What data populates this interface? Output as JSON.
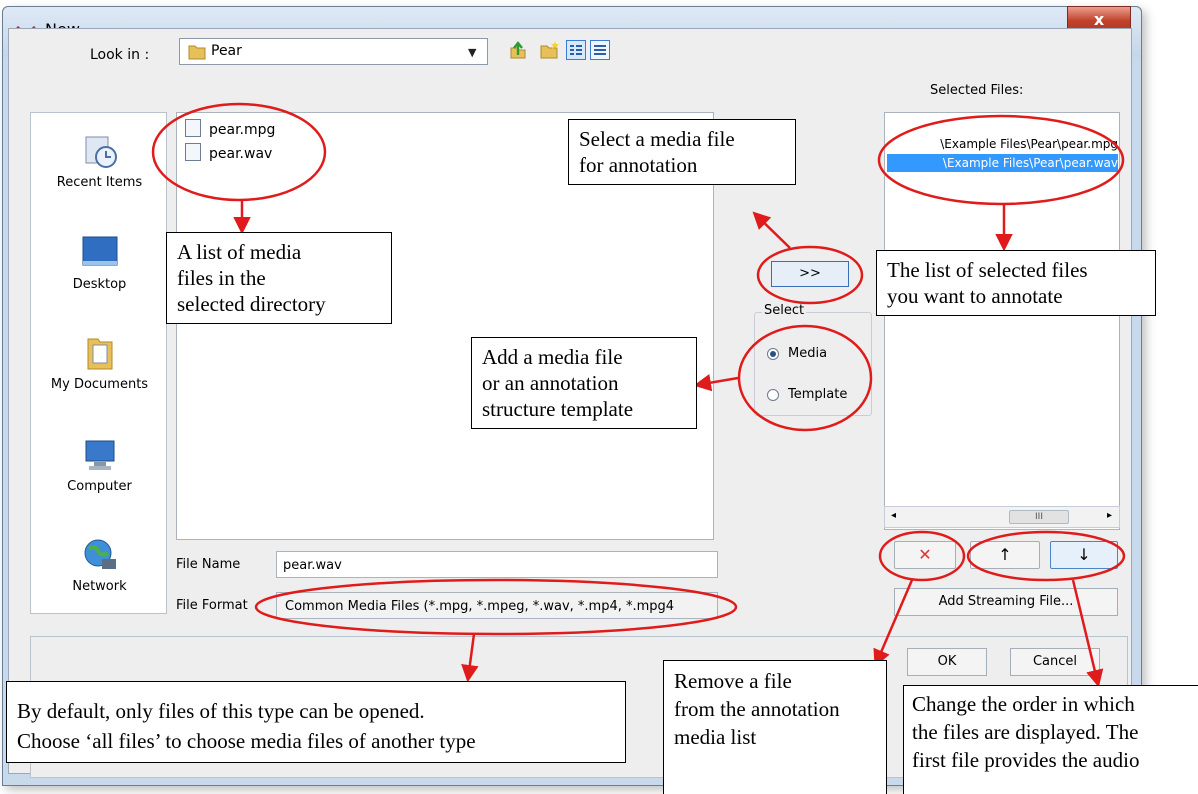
{
  "window": {
    "title": "New",
    "close_label": "x"
  },
  "look_in": {
    "label": "Look in :",
    "value": "Pear"
  },
  "places": [
    {
      "label": "Recent Items",
      "icon": "recent-items-icon"
    },
    {
      "label": "Desktop",
      "icon": "desktop-icon"
    },
    {
      "label": "My Documents",
      "icon": "my-documents-icon"
    },
    {
      "label": "Computer",
      "icon": "computer-icon"
    },
    {
      "label": "Network",
      "icon": "network-icon"
    }
  ],
  "files": [
    {
      "name": "pear.mpg",
      "icon": "video-file-icon"
    },
    {
      "name": "pear.wav",
      "icon": "audio-file-icon"
    }
  ],
  "file_name": {
    "label": "File Name",
    "value": "pear.wav"
  },
  "file_format": {
    "label": "File Format",
    "value": "Common Media Files (*.mpg, *.mpeg, *.wav, *.mp4, *.mpg4"
  },
  "add_button": ">>",
  "select_group": {
    "title": "Select",
    "media": "Media",
    "template": "Template",
    "selected": "Media"
  },
  "selected_files": {
    "heading": "Selected Files:",
    "items": [
      "\\Example Files\\Pear\\pear.mpg",
      "\\Example Files\\Pear\\pear.wav"
    ],
    "scroll_thumb": "III"
  },
  "buttons": {
    "remove": "✕",
    "up": "↑",
    "down": "↓",
    "add_streaming": "Add Streaming File...",
    "ok": "OK",
    "cancel": "Cancel"
  },
  "callouts": {
    "media_list": [
      "A list of media",
      "files in the",
      "selected directory"
    ],
    "select_media": [
      "Select a media file",
      "for annotation"
    ],
    "selected_list": [
      "The list of selected files",
      "you want to annotate"
    ],
    "add_media": [
      "Add a media file",
      "or an annotation",
      "structure template"
    ],
    "default_type": [
      "By default, only files of this type can be opened.",
      "Choose ‘all files’ to choose media files of another type"
    ],
    "remove_file": [
      "Remove a file",
      "from the annotation",
      "media list"
    ],
    "order": [
      "Change the order in which",
      "the files are displayed. The",
      "first file provides the audio"
    ]
  },
  "colors": {
    "annotation_red": "#e01b1b",
    "selection_blue": "#3399ff",
    "window_frame": "#c9d9ec"
  }
}
